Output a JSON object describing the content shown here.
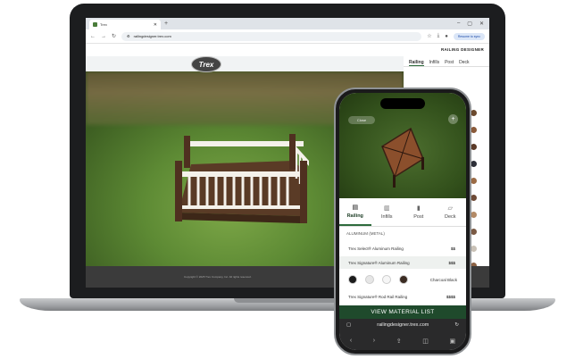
{
  "browser": {
    "tab_title": "Trex",
    "url": "railingdesigner.trex.com",
    "resume_label": "Resume to sync"
  },
  "site": {
    "header_title": "RAILING DESIGNER",
    "logo_text": "Trex",
    "panel_tabs": [
      "Railing",
      "Infills",
      "Post",
      "Deck"
    ],
    "footer_text": "Copyright © 2025 Trex Company, Inc. All rights reserved."
  },
  "desktop_swatches": [
    "#6b4a2e",
    "#8a5a3a",
    "#5b3a28",
    "#2d2f38",
    "#9b6b45",
    "#6e4a36",
    "#b38a66",
    "#7a5a44",
    "#c9c1b6",
    "#8c6244"
  ],
  "phone": {
    "close_label": "Close",
    "tabs": [
      {
        "label": "Railing",
        "icon": "railing-icon"
      },
      {
        "label": "Infills",
        "icon": "infill-icon"
      },
      {
        "label": "Post",
        "icon": "post-icon"
      },
      {
        "label": "Deck",
        "icon": "deck-icon"
      }
    ],
    "section_label": "ALUMINUM (METAL)",
    "options": [
      {
        "name": "Trex Select® Aluminum Railing",
        "price": "$$"
      },
      {
        "name": "Trex Signature® Aluminum Railing",
        "price": "$$$"
      }
    ],
    "color_dots": [
      "#1b1b1b",
      "#e6e6e6",
      "#f6f6f6",
      "#3b2b22"
    ],
    "selected_color": "Charcoal Black",
    "extra_option": {
      "name": "Trex Signature® Rod Rail Railing",
      "price": "$$$$"
    },
    "view_button": "VIEW MATERIAL LIST",
    "url": "railingdesigner.trex.com"
  }
}
